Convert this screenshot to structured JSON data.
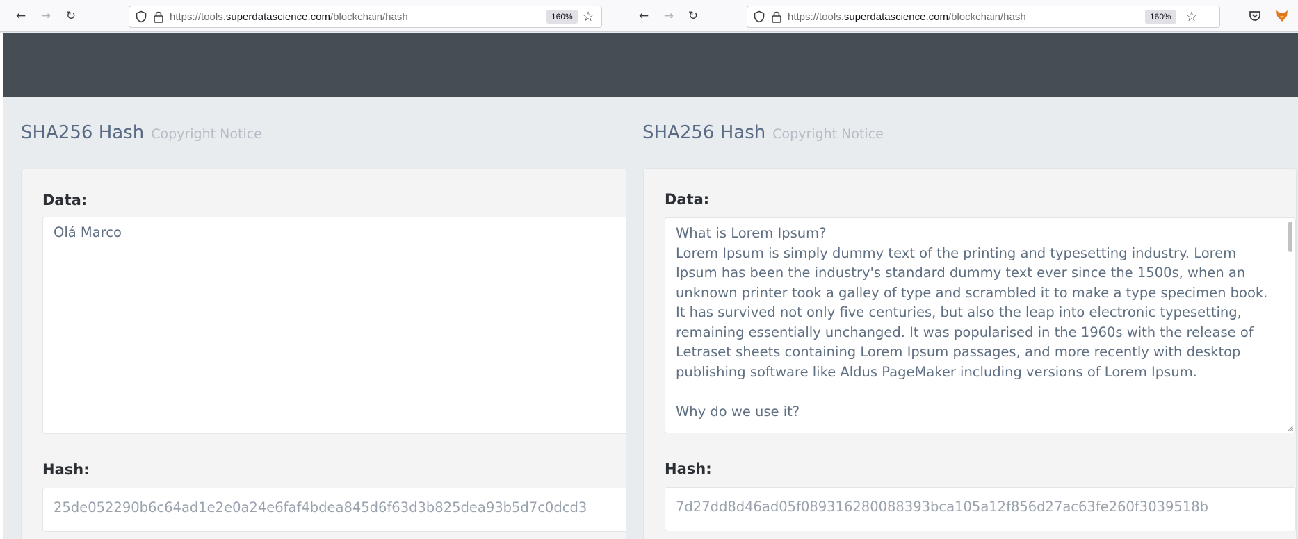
{
  "left": {
    "url_prefix": "https://tools.",
    "url_domain": "superdatascience.com",
    "url_path": "/blockchain/hash",
    "zoom": "160%",
    "page_title": "SHA256 Hash",
    "page_subtitle": "Copyright Notice",
    "data_label": "Data:",
    "data_value": "Olá Marco",
    "hash_label": "Hash:",
    "hash_value": "25de052290b6c64ad1e2e0a24e6faf4bdea845d6f63d3b825dea93b5d7c0dcd3"
  },
  "right": {
    "url_prefix": "https://tools.",
    "url_domain": "superdatascience.com",
    "url_path": "/blockchain/hash",
    "zoom": "160%",
    "page_title": "SHA256 Hash",
    "page_subtitle": "Copyright Notice",
    "data_label": "Data:",
    "data_value": "What is Lorem Ipsum?\nLorem Ipsum is simply dummy text of the printing and typesetting industry. Lorem Ipsum has been the industry's standard dummy text ever since the 1500s, when an unknown printer took a galley of type and scrambled it to make a type specimen book. It has survived not only five centuries, but also the leap into electronic typesetting, remaining essentially unchanged. It was popularised in the 1960s with the release of Letraset sheets containing Lorem Ipsum passages, and more recently with desktop publishing software like Aldus PageMaker including versions of Lorem Ipsum.\n\nWhy do we use it?",
    "hash_label": "Hash:",
    "hash_value": "7d27dd8d46ad05f089316280088393bca105a12f856d27ac63fe260f3039518b"
  },
  "icons": {
    "back": "back-arrow-icon",
    "forward": "forward-arrow-icon",
    "reload": "reload-icon",
    "shield": "tracking-shield-icon",
    "lock": "lock-icon",
    "bookmark": "star-icon",
    "pocket": "pocket-icon",
    "extension": "fox-extension-icon"
  },
  "colors": {
    "navbar": "#454d55",
    "page_bg": "#e9ecef",
    "title": "#5a6b85",
    "hash_text": "#9aa3ad"
  }
}
